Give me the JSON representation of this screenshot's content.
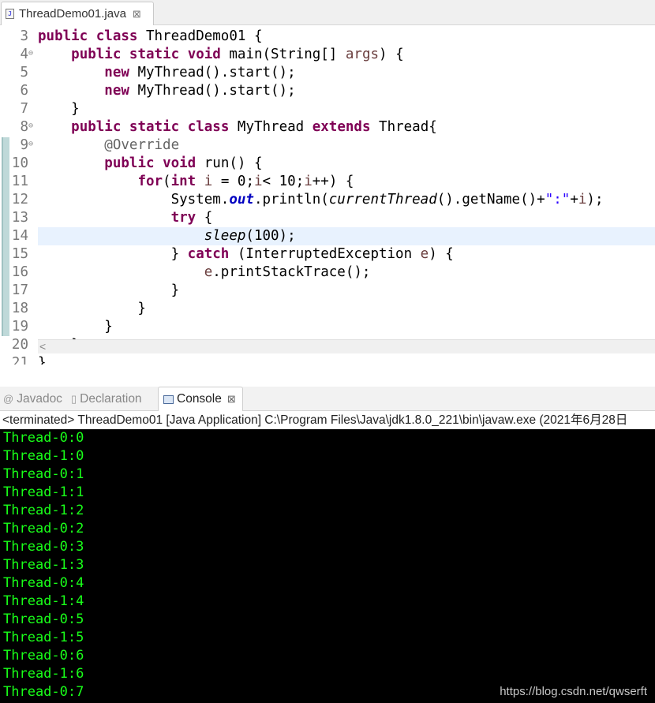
{
  "editor_tab": {
    "title": "ThreadDemo01.java",
    "close": "⊠"
  },
  "code": {
    "lines": [
      {
        "num": "3",
        "fold": "",
        "parts": [
          [
            "kw",
            "public"
          ],
          [
            "t",
            " "
          ],
          [
            "kw",
            "class"
          ],
          [
            "t",
            " ThreadDemo01 {"
          ]
        ]
      },
      {
        "num": "4",
        "fold": "⊖",
        "parts": [
          [
            "t",
            "    "
          ],
          [
            "kw",
            "public"
          ],
          [
            "t",
            " "
          ],
          [
            "kw",
            "static"
          ],
          [
            "t",
            " "
          ],
          [
            "kw",
            "void"
          ],
          [
            "t",
            " main(String[] "
          ],
          [
            "var",
            "args"
          ],
          [
            "t",
            ") {"
          ]
        ]
      },
      {
        "num": "5",
        "fold": "",
        "parts": [
          [
            "t",
            "        "
          ],
          [
            "kw",
            "new"
          ],
          [
            "t",
            " MyThread().start();"
          ]
        ]
      },
      {
        "num": "6",
        "fold": "",
        "parts": [
          [
            "t",
            "        "
          ],
          [
            "kw",
            "new"
          ],
          [
            "t",
            " MyThread().start();"
          ]
        ]
      },
      {
        "num": "7",
        "fold": "",
        "parts": [
          [
            "t",
            "    }"
          ]
        ]
      },
      {
        "num": "8",
        "fold": "⊖",
        "parts": [
          [
            "t",
            "    "
          ],
          [
            "kw",
            "public"
          ],
          [
            "t",
            " "
          ],
          [
            "kw",
            "static"
          ],
          [
            "t",
            " "
          ],
          [
            "kw",
            "class"
          ],
          [
            "t",
            " MyThread "
          ],
          [
            "kw",
            "extends"
          ],
          [
            "t",
            " Thread{"
          ]
        ]
      },
      {
        "num": "9",
        "fold": "⊖",
        "parts": [
          [
            "t",
            "        "
          ],
          [
            "ann",
            "@Override"
          ]
        ]
      },
      {
        "num": "10",
        "fold": "",
        "parts": [
          [
            "t",
            "        "
          ],
          [
            "kw",
            "public"
          ],
          [
            "t",
            " "
          ],
          [
            "kw",
            "void"
          ],
          [
            "t",
            " run() {"
          ]
        ]
      },
      {
        "num": "11",
        "fold": "",
        "parts": [
          [
            "t",
            "            "
          ],
          [
            "kw",
            "for"
          ],
          [
            "t",
            "("
          ],
          [
            "kw",
            "int"
          ],
          [
            "t",
            " "
          ],
          [
            "var",
            "i"
          ],
          [
            "t",
            " = 0;"
          ],
          [
            "var",
            "i"
          ],
          [
            "t",
            "< 10;"
          ],
          [
            "var",
            "i"
          ],
          [
            "t",
            "++) {"
          ]
        ]
      },
      {
        "num": "12",
        "fold": "",
        "parts": [
          [
            "t",
            "                System."
          ],
          [
            "fld",
            "out"
          ],
          [
            "t",
            ".println("
          ],
          [
            "ital",
            "currentThread"
          ],
          [
            "t",
            "().getName()+"
          ],
          [
            "str",
            "\":\""
          ],
          [
            "t",
            "+"
          ],
          [
            "var",
            "i"
          ],
          [
            "t",
            ");"
          ]
        ]
      },
      {
        "num": "13",
        "fold": "",
        "parts": [
          [
            "t",
            "                "
          ],
          [
            "kw",
            "try"
          ],
          [
            "t",
            " {"
          ]
        ]
      },
      {
        "num": "14",
        "fold": "",
        "current": true,
        "parts": [
          [
            "t",
            "                    "
          ],
          [
            "ital",
            "sleep"
          ],
          [
            "t",
            "(100);"
          ]
        ]
      },
      {
        "num": "15",
        "fold": "",
        "parts": [
          [
            "t",
            "                } "
          ],
          [
            "kw",
            "catch"
          ],
          [
            "t",
            " (InterruptedException "
          ],
          [
            "var",
            "e"
          ],
          [
            "t",
            ") {"
          ]
        ]
      },
      {
        "num": "16",
        "fold": "",
        "parts": [
          [
            "t",
            "                    "
          ],
          [
            "var",
            "e"
          ],
          [
            "t",
            ".printStackTrace();"
          ]
        ]
      },
      {
        "num": "17",
        "fold": "",
        "parts": [
          [
            "t",
            "                }"
          ]
        ]
      },
      {
        "num": "18",
        "fold": "",
        "parts": [
          [
            "t",
            "            }"
          ]
        ]
      },
      {
        "num": "19",
        "fold": "",
        "parts": [
          [
            "t",
            "        }"
          ]
        ]
      },
      {
        "num": "20",
        "fold": "",
        "parts": [
          [
            "t",
            "    }"
          ]
        ]
      },
      {
        "num": "21",
        "fold": "",
        "parts": [
          [
            "t",
            "}"
          ]
        ]
      }
    ]
  },
  "panel_tabs": [
    {
      "label": "Javadoc",
      "icon": "at-icon",
      "active": false
    },
    {
      "label": "Declaration",
      "icon": "declaration-icon",
      "active": false
    },
    {
      "label": "Console",
      "icon": "console-icon",
      "active": true,
      "close": "⊠"
    }
  ],
  "console": {
    "header": "<terminated> ThreadDemo01 [Java Application] C:\\Program Files\\Java\\jdk1.8.0_221\\bin\\javaw.exe (2021年6月28日",
    "lines": [
      "Thread-0:0",
      "Thread-1:0",
      "Thread-0:1",
      "Thread-1:1",
      "Thread-1:2",
      "Thread-0:2",
      "Thread-0:3",
      "Thread-1:3",
      "Thread-0:4",
      "Thread-1:4",
      "Thread-0:5",
      "Thread-1:5",
      "Thread-0:6",
      "Thread-1:6",
      "Thread-0:7"
    ],
    "watermark": "https://blog.csdn.net/qwserft"
  },
  "colors": {
    "keyword": "#7f0055",
    "annotation": "#646464",
    "field": "#0000c0",
    "string": "#2a00ff",
    "variable": "#6a3e3e",
    "console_bg": "#000000",
    "console_text": "#19ff19"
  }
}
